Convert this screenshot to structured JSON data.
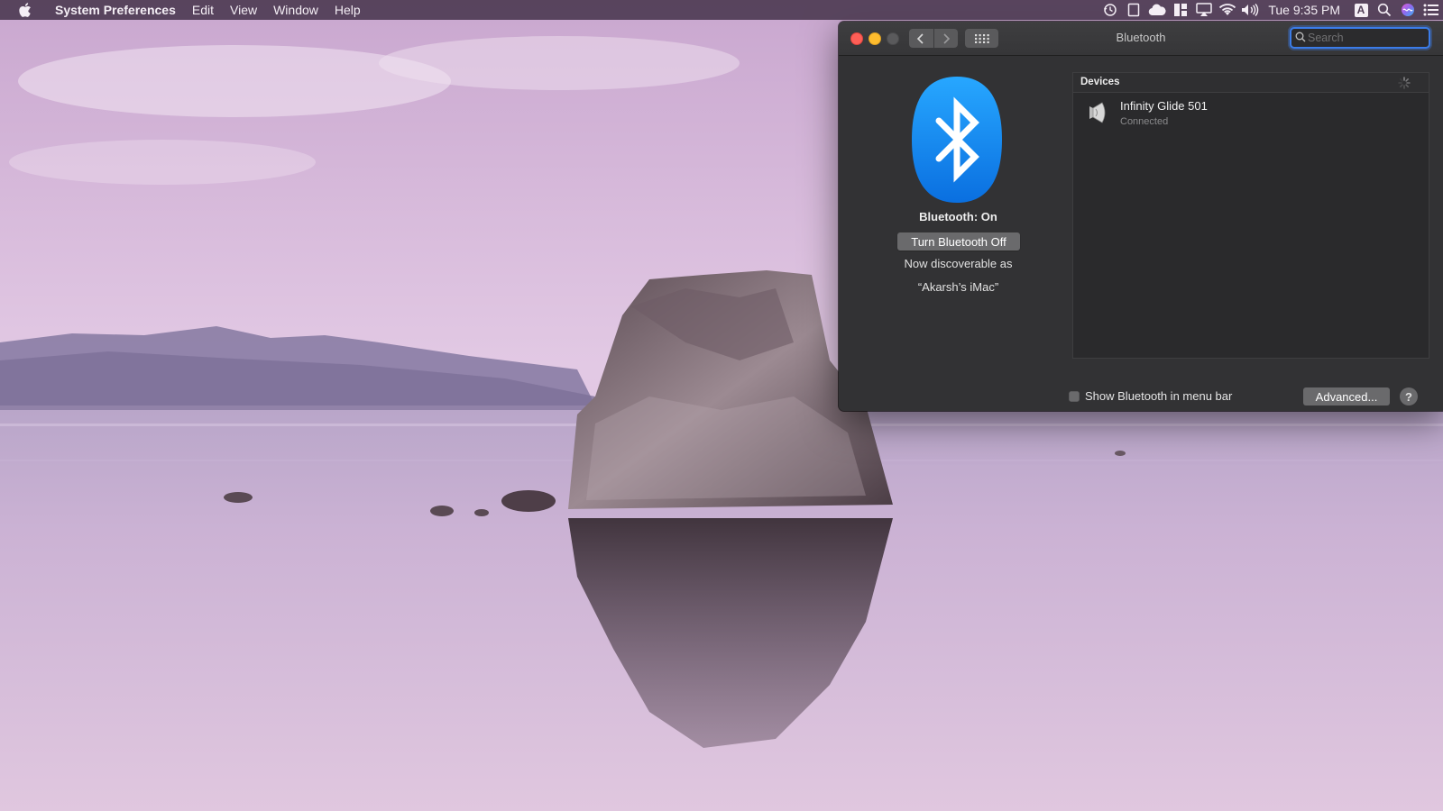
{
  "menubar": {
    "app_name": "System Preferences",
    "menus": [
      "Edit",
      "View",
      "Window",
      "Help"
    ],
    "clock": "Tue 9:35 PM",
    "input_source": "A",
    "status_icons": [
      "time-machine-icon",
      "screen-mirror-icon",
      "cloud-icon",
      "layout-icon",
      "airplay-icon",
      "wifi-icon",
      "volume-icon",
      "input-source-icon",
      "spotlight-icon",
      "siri-icon",
      "notification-center-icon"
    ]
  },
  "window": {
    "title": "Bluetooth",
    "search_placeholder": "Search"
  },
  "bluetooth": {
    "status": "Bluetooth: On",
    "toggle_label": "Turn Bluetooth Off",
    "discoverable_text": "Now discoverable as",
    "device_name": "“Akarsh’s iMac”",
    "accent_color": "#1a8cf5"
  },
  "devices": {
    "header": "Devices",
    "items": [
      {
        "name": "Infinity Glide 501",
        "status": "Connected",
        "icon": "speaker-icon"
      }
    ]
  },
  "footer": {
    "show_in_menubar_label": "Show Bluetooth in menu bar",
    "show_in_menubar_checked": false,
    "advanced_label": "Advanced...",
    "help_label": "?"
  }
}
